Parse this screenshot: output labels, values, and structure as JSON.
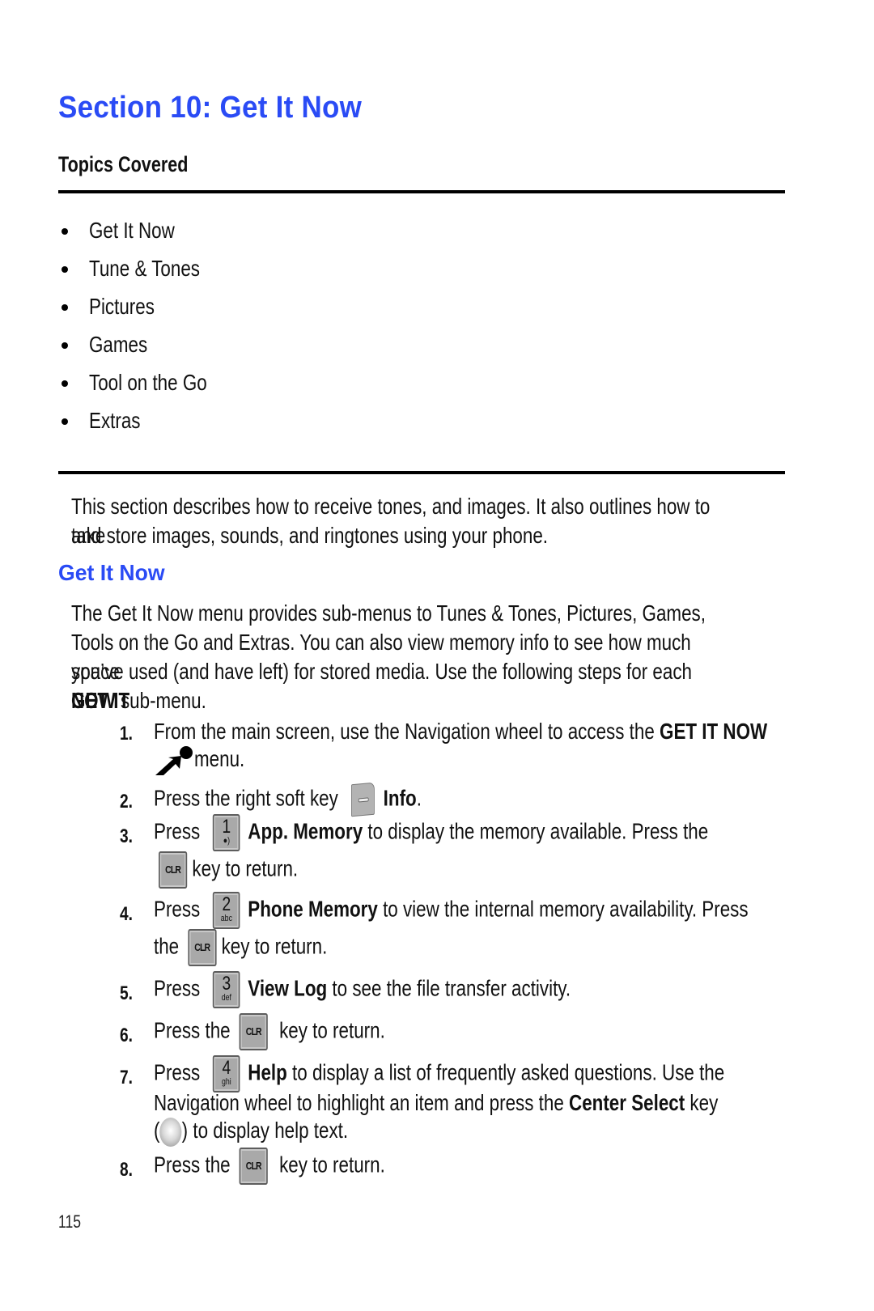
{
  "page": {
    "title": "Section 10: Get It Now",
    "topics_heading": "Topics Covered",
    "topics": [
      "Get It Now",
      "Tune & Tones",
      "Pictures",
      "Games",
      "Tool on the Go",
      "Extras"
    ],
    "intro": [
      "This section describes how to receive tones, and images. It also outlines how to take",
      "and store images, sounds, and ringtones using your phone."
    ],
    "subsection_title": "Get It Now",
    "body": {
      "line1": "The Get It Now menu provides sub-menus to Tunes & Tones, Pictures, Games,",
      "line2": "Tools on the Go and Extras. You can also view memory info to see how much space",
      "line3_pre": "you’ve used (and have left) for stored media. Use the following steps for each ",
      "line3_bold": "GET IT",
      "line4_bold": "NOW",
      "line4_post": " sub-menu."
    },
    "page_number": "115",
    "accent_color": "#2a4bf5"
  },
  "steps": {
    "s1": {
      "num": "1.",
      "pre": "From the main screen, use the Navigation wheel to access the ",
      "bold": "GET IT NOW",
      "line2": " menu.",
      "icon": "get-it-now-icon"
    },
    "s2": {
      "num": "2.",
      "pre": "Press the right soft key ",
      "bold": "Info",
      "post": ".",
      "icon": "right-soft-key-icon"
    },
    "s3": {
      "num": "3.",
      "pre": "Press ",
      "key_num": "1",
      "key_sub": "",
      "bold": "App. Memory",
      "post": " to display the memory available. Press the",
      "line2": " key to return.",
      "key2": "CLR"
    },
    "s4": {
      "num": "4.",
      "pre": "Press ",
      "key_num": "2",
      "key_sub": "abc",
      "bold": "Phone Memory",
      "post": " to view the internal memory availability. Press",
      "line2_pre": "the ",
      "line2": " key to return.",
      "key2": "CLR"
    },
    "s5": {
      "num": "5.",
      "pre": "Press ",
      "key_num": "3",
      "key_sub": "def",
      "bold": "View Log",
      "post": " to see the file transfer activity."
    },
    "s6": {
      "num": "6.",
      "pre": "Press the ",
      "key": "CLR",
      "post": " key to return."
    },
    "s7": {
      "num": "7.",
      "pre": "Press ",
      "key_num": "4",
      "key_sub": "ghi",
      "bold": "Help",
      "post": " to display a list of frequently asked questions. Use the",
      "line2_pre": "Navigation wheel to highlight an item and press the ",
      "line2_bold": "Center Select",
      "line2_post": " key",
      "line3_open": "(",
      "line3_post": ") to display help text."
    },
    "s8": {
      "num": "8.",
      "pre": "Press the ",
      "key": "CLR",
      "post": " key to return."
    }
  }
}
